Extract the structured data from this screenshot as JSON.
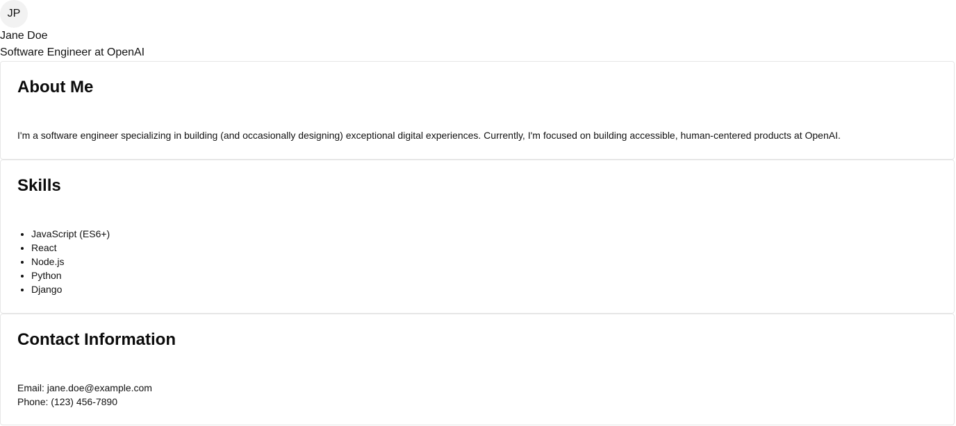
{
  "profile": {
    "initials": "JP",
    "name": "Jane Doe",
    "role": "Software Engineer at OpenAI"
  },
  "about": {
    "title": "About Me",
    "text": "I'm a software engineer specializing in building (and occasionally designing) exceptional digital experiences. Currently, I'm focused on building accessible, human-centered products at OpenAI."
  },
  "skills": {
    "title": "Skills",
    "items": [
      "JavaScript (ES6+)",
      "React",
      "Node.js",
      "Python",
      "Django"
    ]
  },
  "contact": {
    "title": "Contact Information",
    "email_line": "Email: jane.doe@example.com",
    "phone_line": "Phone: (123) 456-7890"
  }
}
